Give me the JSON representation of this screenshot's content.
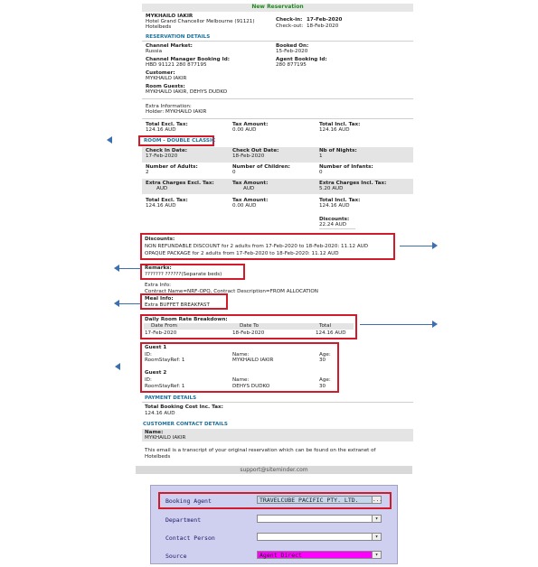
{
  "email": {
    "header_title": "New Reservation",
    "guest_name_top": "MYKHAILO IAKIR",
    "hotel": "Hotel Grand Chancellor Melbourne (91121)",
    "supplier": "Hotelbeds",
    "check_in_label": "Check-in:",
    "check_in": "17-Feb-2020",
    "check_out_label": "Check-out:",
    "check_out": "18-Feb-2020",
    "reservation_details": "RESERVATION DETAILS",
    "channel_market_label": "Channel Market:",
    "channel_market": "Russia",
    "booked_on_label": "Booked On:",
    "booked_on": "15-Feb-2020",
    "cm_booking_id_label": "Channel Manager Booking Id:",
    "cm_booking_id": "HBD 91121 280 877195",
    "agent_booking_id_label": "Agent Booking Id:",
    "agent_booking_id": "280 877195",
    "customer_label": "Customer:",
    "customer": "MYKHAILO IAKIR",
    "room_guests_label": "Room Guests:",
    "room_guests": "MYKHAILO IAKIR, DEHYS DUDKO",
    "extra_info_label": "Extra Information:",
    "extra_info": "Holder: MYKHAILO IAKIR",
    "total_excl_label": "Total Excl. Tax:",
    "total_excl": "124.16 AUD",
    "tax_amount_label": "Tax Amount:",
    "tax_amount": "0.00 AUD",
    "total_incl_label": "Total Incl. Tax:",
    "total_incl": "124.16 AUD",
    "room_title": "ROOM - DOUBLE CLASSIC",
    "r_check_in_label": "Check In Date:",
    "r_check_in": "17-Feb-2020",
    "r_check_out_label": "Check Out Date:",
    "r_check_out": "18-Feb-2020",
    "nights_label": "Nb of Nights:",
    "nights": "1",
    "adults_label": "Number of Adults:",
    "adults": "2",
    "children_label": "Number of Children:",
    "children": "0",
    "infants_label": "Number of Infants:",
    "infants": "0",
    "extra_excl_label": "Extra Charges Excl. Tax:",
    "extra_excl": "AUD",
    "r_tax_label": "Tax Amount:",
    "r_tax": "AUD",
    "extra_incl_label": "Extra Charges Incl. Tax:",
    "extra_incl": "5.20 AUD",
    "r_total_excl_label": "Total Excl. Tax:",
    "r_total_excl": "124.16 AUD",
    "r_tax2_label": "Tax Amount:",
    "r_tax2": "0.00 AUD",
    "r_total_incl_label": "Total Incl. Tax:",
    "r_total_incl": "124.16 AUD",
    "discounts_total_label": "Discounts:",
    "discounts_total": "22.24 AUD",
    "discounts_label": "Discounts:",
    "discount_1": "NON REFUNDABLE DISCOUNT for 2 adults from 17-Feb-2020 to 18-Feb-2020: 11.12 AUD",
    "discount_2": "OPAQUE PACKAGE for 2 adults from 17-Feb-2020 to 18-Feb-2020: 11.12 AUD",
    "remarks_label": "Remarks:",
    "remarks": "??????? ??????(Separate beds)",
    "extra_info2_label": "Extra Info:",
    "extra_info2": "Contract Name=NRF-OPQ, Contract Description=FROM ALLOCATION",
    "meal_label": "Meal Info:",
    "meal": "Extra BUFFET BREAKFAST",
    "daily_label": "Daily Room Rate Breakdown:",
    "daily_cols": [
      "Date From",
      "Date To",
      "Total"
    ],
    "daily_row": [
      "17-Feb-2020",
      "18-Feb-2020",
      "124.16 AUD"
    ],
    "guest1_label": "Guest 1",
    "guest2_label": "Guest 2",
    "id_label": "ID:",
    "name_label": "Name:",
    "age_label": "Age:",
    "roomstay_1": "RoomStayRef: 1",
    "guest1_name": "MYKHAILO IAKIR",
    "guest1_age": "30",
    "roomstay_2": "RoomStayRef: 1",
    "guest2_name": "DEHYS DUDKO",
    "guest2_age": "30",
    "payment_details": "PAYMENT DETAILS",
    "total_booking_label": "Total Booking Cost Inc. Tax:",
    "total_booking": "124.16 AUD",
    "contact_details": "CUSTOMER CONTACT DETAILS",
    "contact_name_label": "Name:",
    "contact_name": "MYKHAILO IAKIR",
    "transcript_1": "This email is a transcript of your original reservation which can be found on the extranet of",
    "transcript_2": "Hotelbeds",
    "footer": "support@siteminder.com"
  },
  "form": {
    "booking_agent_label": "Booking Agent",
    "booking_agent_value": "TRAVELCUBE PACIFIC PTY. LTD.",
    "booking_agent_btn": "...",
    "department_label": "Department",
    "contact_person_label": "Contact Person",
    "source_label": "Source",
    "source_value": "Agent Direct",
    "dropdown_glyph": "▾"
  },
  "colors": {
    "highlight_box": "#d11a2a",
    "arrow": "#3a6fb0",
    "section": "#1b6f9c",
    "form_bg": "#cfcff0",
    "source_bg": "#ff00ff"
  }
}
